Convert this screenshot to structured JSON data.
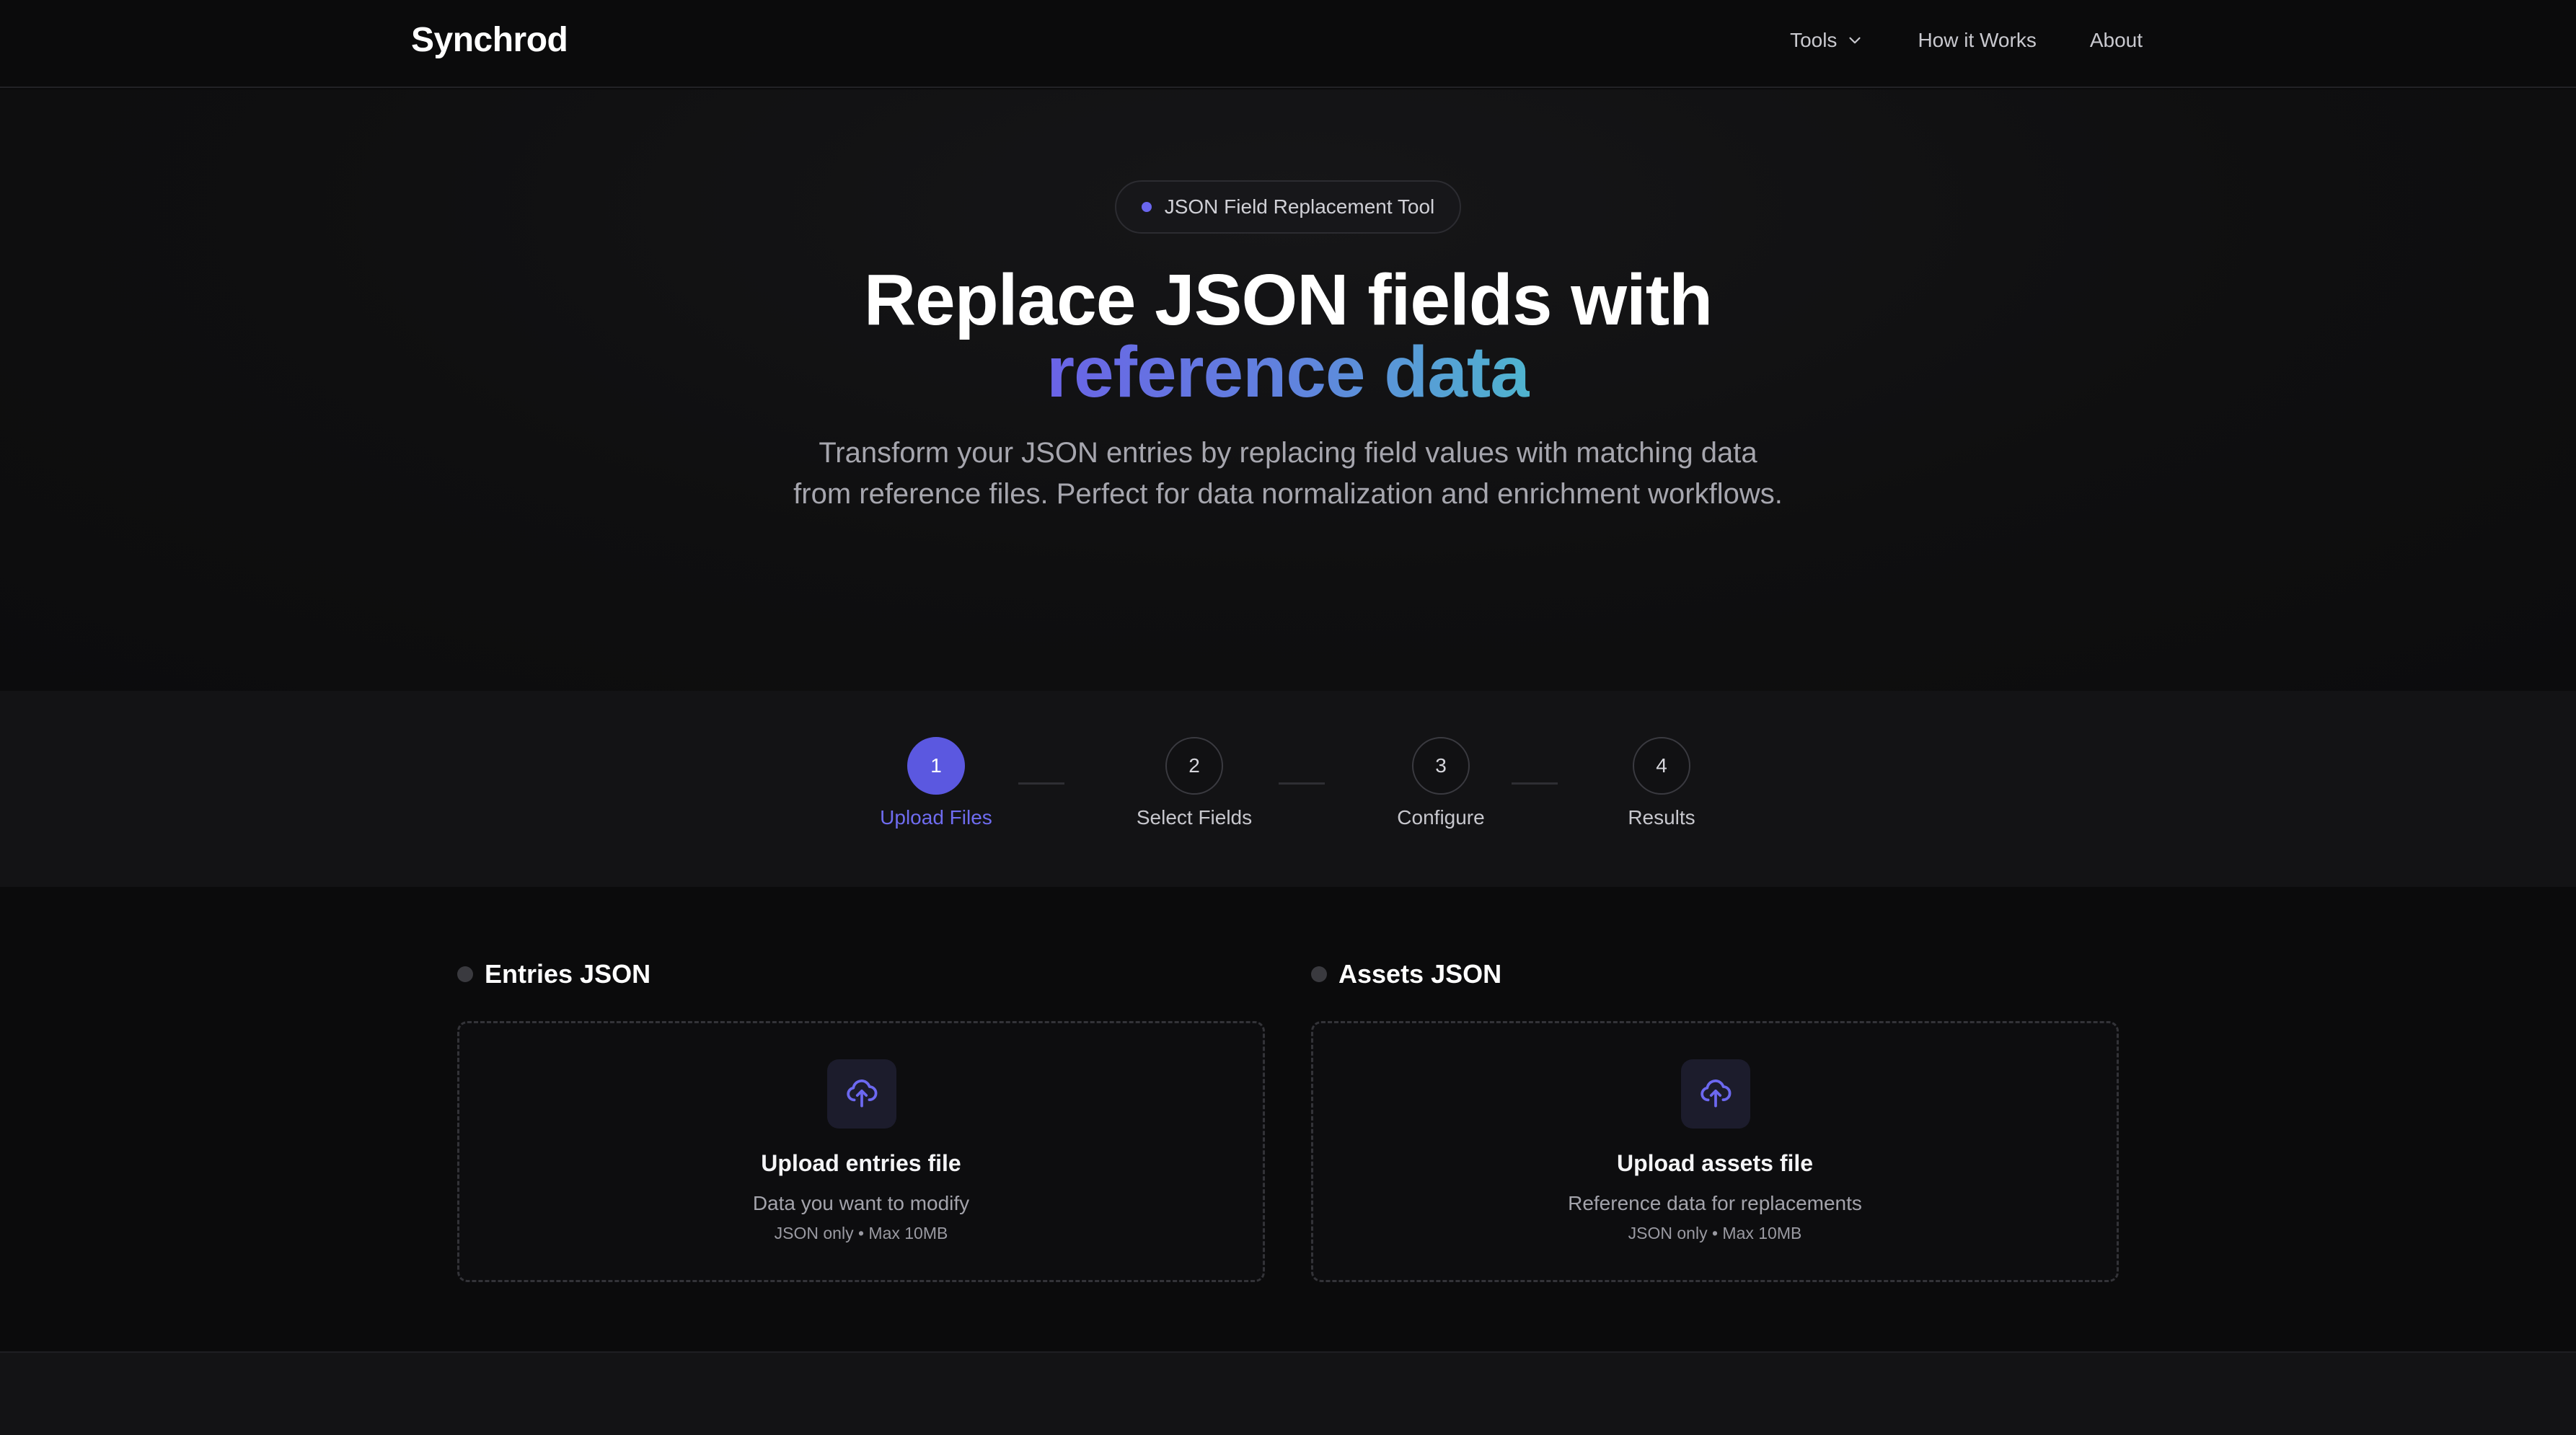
{
  "header": {
    "brand": "Synchrod",
    "nav": [
      {
        "label": "Tools",
        "has_dropdown": true
      },
      {
        "label": "How it Works"
      },
      {
        "label": "About"
      }
    ]
  },
  "hero": {
    "badge": "JSON Field Replacement Tool",
    "title_line1": "Replace JSON fields with",
    "title_line2": "reference data",
    "subtitle": "Transform your JSON entries by replacing field values with matching data from reference files. Perfect for data normalization and enrichment workflows."
  },
  "steps": [
    {
      "number": "1",
      "label": "Upload Files",
      "active": true
    },
    {
      "number": "2",
      "label": "Select Fields",
      "active": false
    },
    {
      "number": "3",
      "label": "Configure",
      "active": false
    },
    {
      "number": "4",
      "label": "Results",
      "active": false
    }
  ],
  "upload": {
    "entries": {
      "title": "Entries JSON",
      "dropzone_title": "Upload entries file",
      "dropzone_desc": "Data you want to modify",
      "dropzone_note": "JSON only • Max 10MB",
      "icon": "upload-cloud-icon"
    },
    "assets": {
      "title": "Assets JSON",
      "dropzone_title": "Upload assets file",
      "dropzone_desc": "Reference data for replacements",
      "dropzone_note": "JSON only • Max 10MB",
      "icon": "upload-cloud-icon"
    }
  },
  "colors": {
    "accent": "#5b58e0",
    "background": "#0b0b0c",
    "gradient_start": "#6a63e6",
    "gradient_end": "#4fb4cf"
  }
}
